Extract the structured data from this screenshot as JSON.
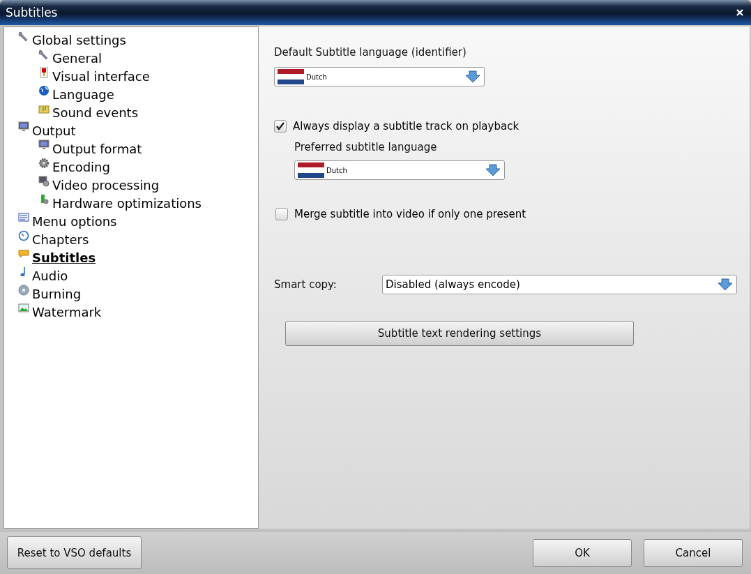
{
  "window": {
    "title": "Subtitles"
  },
  "sidebar": {
    "items": [
      {
        "label": "Global settings",
        "selected": false,
        "children": [
          {
            "label": "General",
            "selected": false
          },
          {
            "label": "Visual interface",
            "selected": false
          },
          {
            "label": "Language",
            "selected": false
          },
          {
            "label": "Sound events",
            "selected": false
          }
        ]
      },
      {
        "label": "Output",
        "selected": false,
        "children": [
          {
            "label": "Output format",
            "selected": false
          },
          {
            "label": "Encoding",
            "selected": false
          },
          {
            "label": "Video processing",
            "selected": false
          },
          {
            "label": "Hardware optimizations",
            "selected": false
          }
        ]
      },
      {
        "label": "Menu options",
        "selected": false
      },
      {
        "label": "Chapters",
        "selected": false
      },
      {
        "label": "Subtitles",
        "selected": true
      },
      {
        "label": "Audio",
        "selected": false
      },
      {
        "label": "Burning",
        "selected": false
      },
      {
        "label": "Watermark",
        "selected": false
      }
    ]
  },
  "default_language": {
    "label": "Default Subtitle language  (identifier)",
    "value": "Dutch"
  },
  "always_display": {
    "label": "Always display a subtitle track on playback",
    "checked": true
  },
  "preferred_language": {
    "label": "Preferred subtitle language",
    "value": "Dutch"
  },
  "merge": {
    "label": "Merge subtitle into video if only one present",
    "checked": false
  },
  "smart_copy": {
    "label": "Smart copy:",
    "value": "Disabled (always encode)"
  },
  "rendering_button": "Subtitle text rendering settings",
  "buttons": {
    "reset": "Reset to VSO defaults",
    "ok": "OK",
    "cancel": "Cancel"
  }
}
